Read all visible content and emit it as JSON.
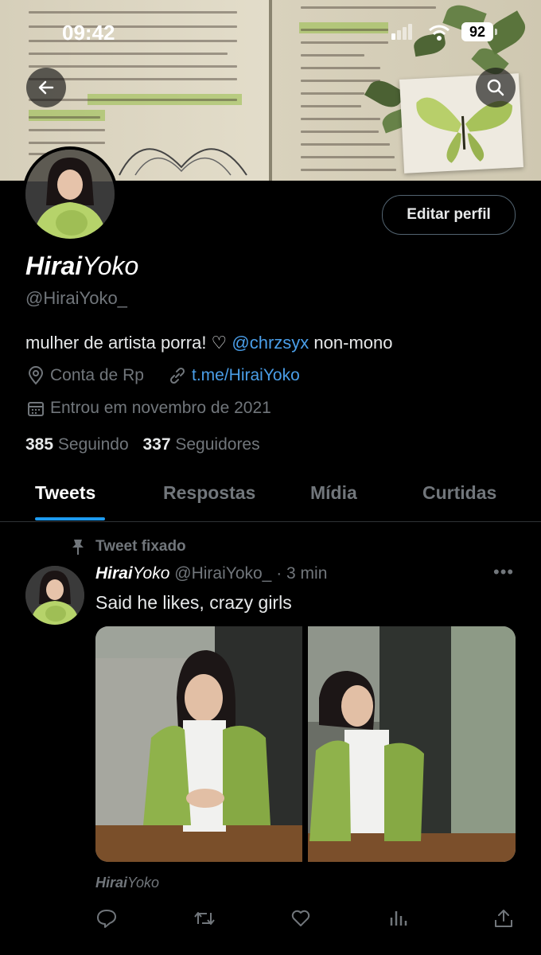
{
  "status_bar": {
    "time": "09:42",
    "battery": "92"
  },
  "profile": {
    "name_bold": "Hirai",
    "name_rest": "Yoko",
    "handle": "@HiraiYoko_",
    "bio_text": "mulher de artista porra! ♡ ",
    "bio_mention": "@chrzsyx",
    "bio_suffix": " non-mono",
    "location": "Conta de Rp",
    "link": "t.me/HiraiYoko",
    "joined": "Entrou em novembro de 2021",
    "following_count": "385",
    "following_label": "Seguindo",
    "followers_count": "337",
    "followers_label": "Seguidores",
    "edit_button": "Editar perfil"
  },
  "tabs": [
    {
      "label": "Tweets",
      "active": true
    },
    {
      "label": "Respostas",
      "active": false
    },
    {
      "label": "Mídia",
      "active": false
    },
    {
      "label": "Curtidas",
      "active": false
    }
  ],
  "pinned_tweet": {
    "pinned_label": "Tweet fixado",
    "author_bold": "Hirai",
    "author_rest": "Yoko",
    "handle": "@HiraiYoko_",
    "separator": "·",
    "time": "3 min",
    "more": "•••",
    "text": "Said he likes, crazy girls",
    "footer_bold": "Hirai",
    "footer_rest": "Yoko"
  },
  "icons": {
    "back": "arrow-left-icon",
    "search": "search-icon",
    "location": "map-pin-icon",
    "link": "link-icon",
    "calendar": "calendar-icon",
    "pin": "pin-icon",
    "reply": "reply-icon",
    "retweet": "retweet-icon",
    "like": "heart-icon",
    "views": "views-icon",
    "share": "share-icon"
  },
  "colors": {
    "accent": "#1d9bf0",
    "link": "#4a9ee8",
    "muted": "#71767b",
    "background": "#000000"
  }
}
